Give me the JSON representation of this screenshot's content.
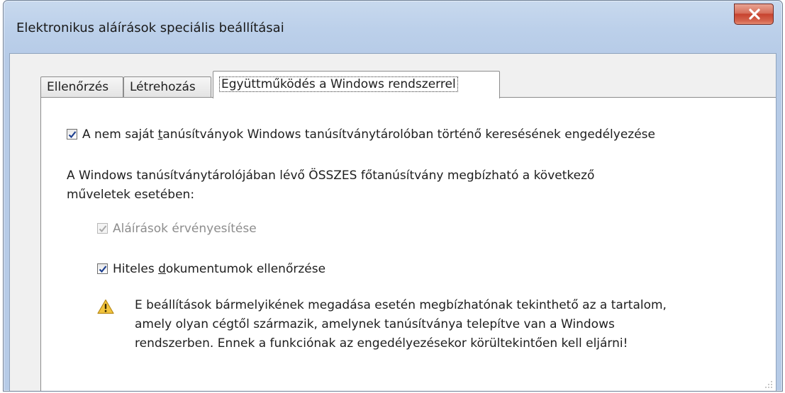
{
  "window": {
    "title": "Elektronikus aláírások speciális beállításai",
    "close_icon": "close-icon"
  },
  "tabs": [
    {
      "label": "Ellenőrzés",
      "active": false
    },
    {
      "label": "Létrehozás",
      "active": false
    },
    {
      "label": "Együttműködés a Windows rendszerrel",
      "active": true
    }
  ],
  "panel": {
    "search_checkbox": {
      "checked": true,
      "label_before": "A nem saját ",
      "label_access": "t",
      "label_after": "anúsítványok Windows tanúsítványtárolóban történő keresésének engedélyezése"
    },
    "trust_text_line1": "A Windows tanúsítványtárolójában lévő ÖSSZES főtanúsítvány megbízható a következő",
    "trust_text_line2": "műveletek esetében:",
    "validate_checkbox": {
      "checked": true,
      "disabled": true,
      "label": "Aláírások érvényesítése"
    },
    "certified_checkbox": {
      "checked": true,
      "label_before": "Hiteles ",
      "label_access": "d",
      "label_after": "okumentumok ellenőrzése"
    },
    "warning": {
      "icon": "warning-icon",
      "line1": "E beállítások bármelyikének megadása esetén megbízhatónak tekinthető az a tartalom,",
      "line2": "amely olyan cégtől származik, amelynek tanúsítványa telepítve van a Windows",
      "line3": "rendszerben. Ennek a funkciónak az engedélyezésekor körültekintően kell eljárni!"
    }
  },
  "colors": {
    "title_bar": "#bcd0ea",
    "close_button": "#c7432f",
    "checkmark": "#1d3f8f",
    "warning_fill": "#f2c43d"
  }
}
